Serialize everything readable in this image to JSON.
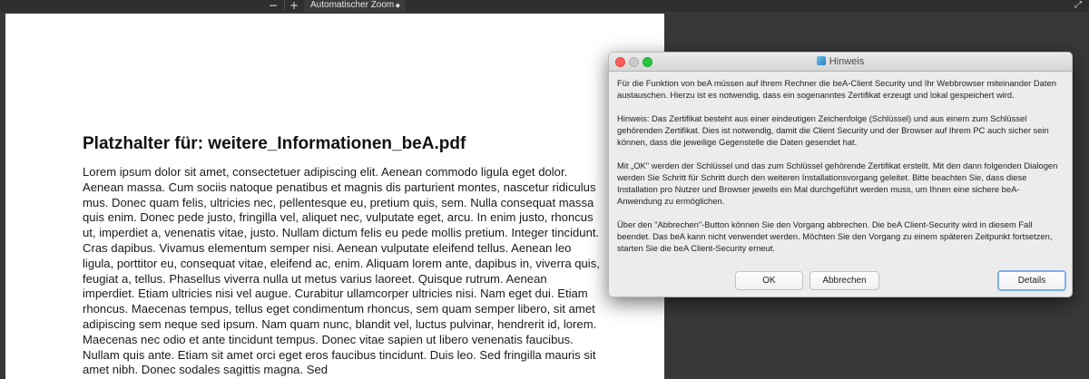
{
  "toolbar": {
    "zoom_out": "−",
    "zoom_in": "+",
    "zoom_label": "Automatischer Zoom",
    "zoom_arrow": "◆",
    "fullscreen": "⤢"
  },
  "page": {
    "title": "Platzhalter für: weitere_Informationen_beA.pdf",
    "body": "Lorem ipsum dolor sit amet, consectetuer adipiscing elit. Aenean commodo ligula eget dolor. Aenean massa. Cum sociis natoque penatibus et magnis dis parturient montes, nascetur ridiculus mus. Donec quam felis, ultricies nec, pellentesque eu, pretium quis, sem. Nulla consequat massa quis enim. Donec pede justo, fringilla vel, aliquet nec, vulputate eget, arcu. In enim justo, rhoncus ut, imperdiet a, venenatis vitae, justo. Nullam dictum felis eu pede mollis pretium. Integer tincidunt. Cras dapibus. Vivamus elementum semper nisi. Aenean vulputate eleifend tellus. Aenean leo ligula, porttitor eu, consequat vitae, eleifend ac, enim. Aliquam lorem ante, dapibus in, viverra quis, feugiat a, tellus. Phasellus viverra nulla ut metus varius laoreet. Quisque rutrum. Aenean imperdiet. Etiam ultricies nisi vel augue. Curabitur ullamcorper ultricies nisi. Nam eget dui. Etiam rhoncus. Maecenas tempus, tellus eget condimentum rhoncus, sem quam semper libero, sit amet adipiscing sem neque sed ipsum. Nam quam nunc, blandit vel, luctus pulvinar, hendrerit id, lorem. Maecenas nec odio et ante tincidunt tempus. Donec vitae sapien ut libero venenatis faucibus. Nullam quis ante. Etiam sit amet orci eget eros faucibus tincidunt. Duis leo. Sed fringilla mauris sit amet nibh. Donec sodales sagittis magna. Sed"
  },
  "dialog": {
    "title": "Hinweis",
    "paragraphs": [
      "Für die Funktion von beA müssen auf Ihrem Rechner die beA-Client Security und Ihr Webbrowser miteinander Daten austauschen. Hierzu ist es notwendig, dass ein sogenanntes Zertifikat erzeugt und lokal gespeichert wird.",
      "Hinweis: Das Zertifikat besteht aus einer eindeutigen Zeichenfolge (Schlüssel) und aus einem zum Schlüssel gehörenden Zertifikat. Dies ist notwendig, damit die Client Security und der Browser auf Ihrem PC auch sicher sein können, dass die jeweilige Gegenstelle die Daten gesendet hat.",
      "Mit „OK\" werden der Schlüssel und das zum Schlüssel gehörende Zertifikat erstellt. Mit den dann folgenden Dialogen werden Sie Schritt für Schritt durch den weiteren Installationsvorgang geleitet. Bitte beachten Sie, dass diese Installation pro Nutzer und Browser jeweils ein Mal durchgeführt werden muss, um Ihnen eine sichere beA-Anwendung zu ermöglichen.",
      "Über den \"Abbrechen\"-Button können Sie den Vorgang abbrechen. Die beA Client-Security wird in diesem Fall beendet. Das beA kann nicht verwendet werden. Möchten Sie den Vorgang zu einem späteren Zeitpunkt fortsetzen, starten Sie die beA Client-Security erneut."
    ],
    "ok_label": "OK",
    "cancel_label": "Abbrechen",
    "details_label": "Details"
  }
}
